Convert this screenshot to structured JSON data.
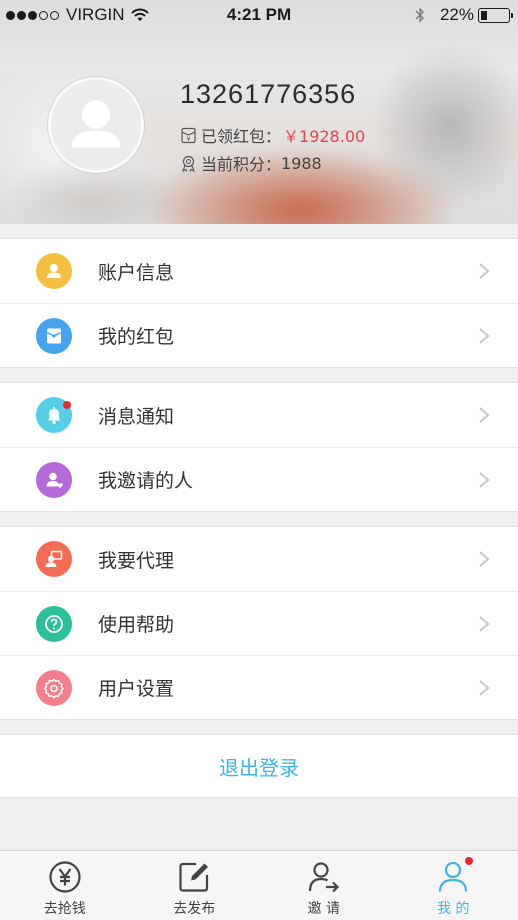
{
  "status_bar": {
    "carrier": "VIRGIN",
    "time": "4:21 PM",
    "battery_text": "22%",
    "battery_level": 0.22,
    "signal_bars_filled": 3,
    "signal_bars_total": 5
  },
  "profile": {
    "phone": "13261776356",
    "red_packet_label": "已领红包：",
    "red_packet_value": "￥1928.00",
    "points_label": "当前积分：",
    "points_value": "1988"
  },
  "menu": {
    "groups": [
      [
        {
          "label": "账户信息",
          "icon": "account-info-icon",
          "color": "#f5c042"
        },
        {
          "label": "我的红包",
          "icon": "red-packet-icon",
          "color": "#46a3ee"
        }
      ],
      [
        {
          "label": "消息通知",
          "icon": "bell-icon",
          "color": "#54cfe6",
          "badge": true
        },
        {
          "label": "我邀请的人",
          "icon": "invited-people-icon",
          "color": "#b46ad9"
        }
      ],
      [
        {
          "label": "我要代理",
          "icon": "agent-icon",
          "color": "#f56b55"
        },
        {
          "label": "使用帮助",
          "icon": "help-icon",
          "color": "#2cbf9a"
        },
        {
          "label": "用户设置",
          "icon": "settings-icon",
          "color": "#f47f8c"
        }
      ]
    ]
  },
  "logout_label": "退出登录",
  "tabbar": {
    "tabs": [
      {
        "label": "去抢钱",
        "icon": "yen-coin-icon"
      },
      {
        "label": "去发布",
        "icon": "edit-icon"
      },
      {
        "label": "邀 请",
        "icon": "invite-user-icon"
      },
      {
        "label": "我 的",
        "icon": "me-icon",
        "active": true,
        "badge": true
      }
    ]
  },
  "colors": {
    "accent": "#3fb5e6",
    "money": "#e8434d",
    "badge": "#e8262c"
  }
}
